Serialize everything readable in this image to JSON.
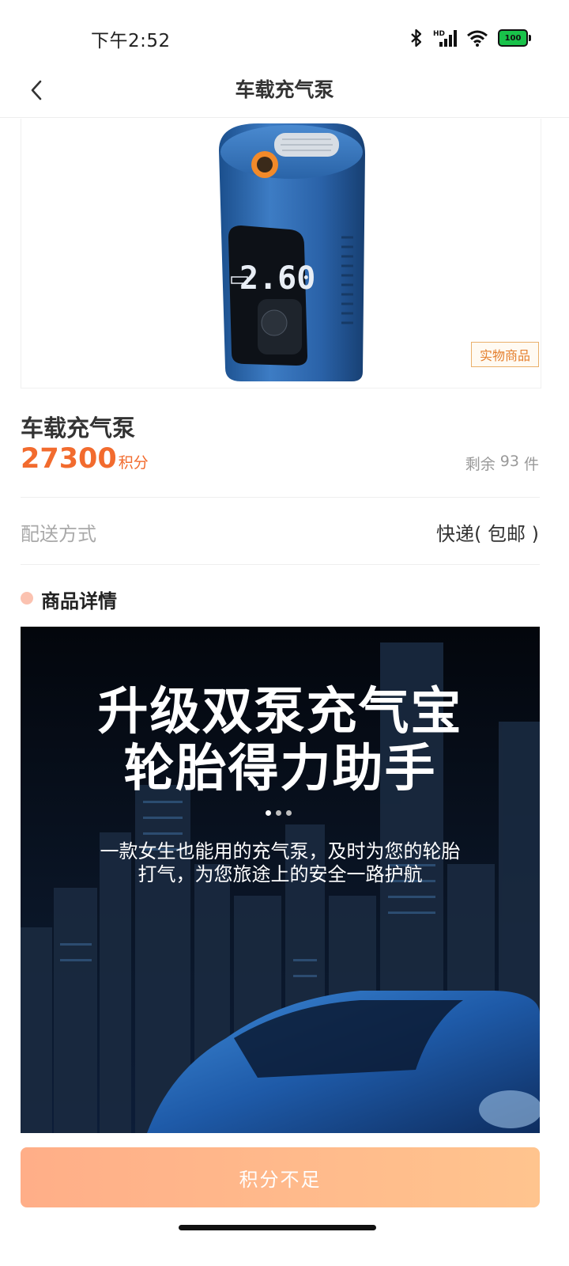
{
  "status_bar": {
    "time": "下午2:52",
    "icons": [
      "bluetooth-icon",
      "signal-icon",
      "wifi-icon",
      "battery-icon"
    ],
    "hd_label": "HD",
    "battery": "100"
  },
  "header": {
    "back_icon": "chevron-left-icon",
    "title": "车载充气泵"
  },
  "product_image": {
    "display_reading": "2.60",
    "tag": "实物商品"
  },
  "product": {
    "name": "车载充气泵",
    "price": "27300",
    "price_unit": "积分",
    "stock_label": "剩余",
    "stock_count": "93",
    "stock_unit": "件"
  },
  "delivery": {
    "label": "配送方式",
    "value": "快递( 包邮 )"
  },
  "details": {
    "title": "商品详情"
  },
  "banner": {
    "headline_1": "升级双泵充气宝",
    "headline_2": "轮胎得力助手",
    "sub_1": "一款女生也能用的充气泵，及时为您的轮胎",
    "sub_2": "打气，为您旅途上的安全一路护航"
  },
  "footer": {
    "button_label": "积分不足"
  },
  "colors": {
    "accent": "#f26b2e",
    "button_start": "#ffae88",
    "button_end": "#ffc48e",
    "tag_border": "#eab06a"
  }
}
